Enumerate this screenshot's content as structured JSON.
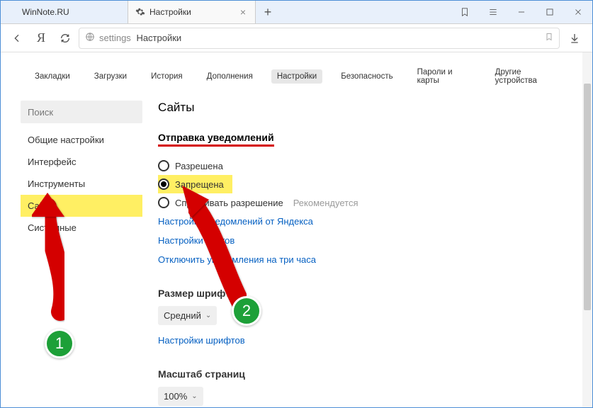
{
  "window": {
    "tabs": [
      {
        "title": "WinNote.RU"
      },
      {
        "title": "Настройки"
      }
    ]
  },
  "toolbar": {
    "address_prefix": "settings",
    "address_title": "Настройки",
    "yandex_letter": "Я"
  },
  "topnav": {
    "items": [
      "Закладки",
      "Загрузки",
      "История",
      "Дополнения",
      "Настройки",
      "Безопасность",
      "Пароли и карты",
      "Другие устройства"
    ],
    "active_index": 4
  },
  "sidebar": {
    "search_placeholder": "Поиск",
    "items": [
      "Общие настройки",
      "Интерфейс",
      "Инструменты",
      "Сайты",
      "Системные"
    ],
    "selected_index": 3
  },
  "main": {
    "heading": "Сайты",
    "notifications": {
      "title": "Отправка уведомлений",
      "options": [
        "Разрешена",
        "Запрещена",
        "Спрашивать разрешение"
      ],
      "selected_index": 1,
      "recommend_hint": "Рекомендуется",
      "links": [
        "Настройки уведомлений от Яндекса",
        "Настройки сайтов",
        "Отключить уведомления на три часа"
      ]
    },
    "font": {
      "title": "Размер шрифта",
      "value": "Средний",
      "link": "Настройки шрифтов"
    },
    "zoom": {
      "title": "Масштаб страниц",
      "value": "100%"
    }
  },
  "annotations": {
    "badge1": "1",
    "badge2": "2"
  }
}
